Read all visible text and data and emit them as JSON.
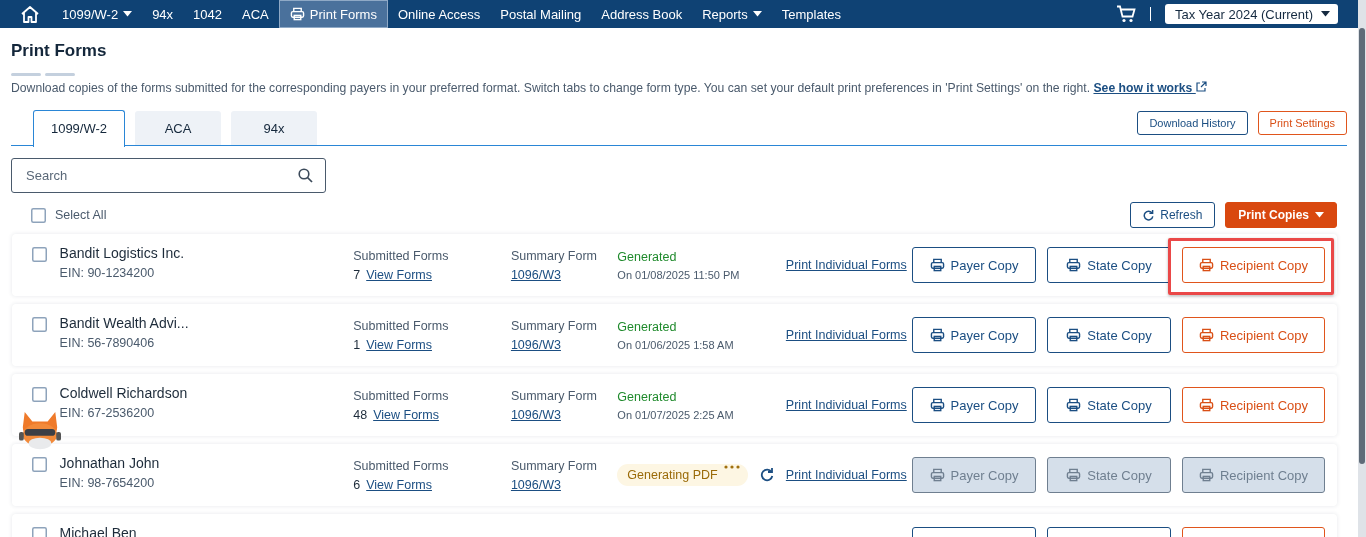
{
  "nav": {
    "items": [
      {
        "label": "1099/W-2",
        "dropdown": true,
        "selected": false
      },
      {
        "label": "94x",
        "dropdown": false,
        "selected": false
      },
      {
        "label": "1042",
        "dropdown": false,
        "selected": false
      },
      {
        "label": "ACA",
        "dropdown": false,
        "selected": false
      },
      {
        "label": "Print Forms",
        "dropdown": false,
        "selected": true,
        "kind": "printer"
      },
      {
        "label": "Online Access",
        "dropdown": false,
        "selected": false
      },
      {
        "label": "Postal Mailing",
        "dropdown": false,
        "selected": false
      },
      {
        "label": "Address Book",
        "dropdown": false,
        "selected": false
      },
      {
        "label": "Reports",
        "dropdown": true,
        "selected": false
      },
      {
        "label": "Templates",
        "dropdown": false,
        "selected": false
      }
    ],
    "tax_year": "Tax Year 2024 (Current)"
  },
  "page": {
    "title": "Print Forms",
    "description": "Download copies of the forms submitted for the corresponding payers in your preferred format. Switch tabs to change form type. You can set your default print preferences in 'Print Settings' on the right.",
    "help_link": "See how it works"
  },
  "tabs": [
    {
      "label": "1099/W-2",
      "selected": true
    },
    {
      "label": "ACA",
      "selected": false
    },
    {
      "label": "94x",
      "selected": false
    }
  ],
  "header_buttons": [
    {
      "label": "Download History",
      "kind": "secondary"
    },
    {
      "label": "Print Settings",
      "kind": "accent"
    }
  ],
  "search": {
    "placeholder": "Search"
  },
  "select_all": {
    "label": "Select All",
    "checked": false
  },
  "actions": [
    {
      "label": "Refresh",
      "kind": "refresh"
    },
    {
      "label": "Print Copies",
      "kind": "primary"
    }
  ],
  "rows": [
    {
      "name": "Bandit Logistics Inc.",
      "ein": "EIN: 90-1234200",
      "checked": false,
      "submitted_label": "Submitted Forms",
      "count": "7",
      "view_link": "View Forms",
      "summary_label": "Summary Form",
      "summary_link": "1096/W3",
      "status": {
        "kind": "generated",
        "label": "Generated",
        "date": "On 01/08/2025 11:50 PM"
      },
      "print_link": "Print Individual Forms",
      "buttons": [
        {
          "label": "Payer Copy",
          "kind": "secondary",
          "disabled": false,
          "highlighted": false
        },
        {
          "label": "State Copy",
          "kind": "secondary",
          "disabled": false,
          "highlighted": false
        },
        {
          "label": "Recipient Copy",
          "kind": "accent",
          "disabled": false,
          "highlighted": true
        }
      ]
    },
    {
      "name": "Bandit Wealth Advi...",
      "ein": "EIN: 56-7890406",
      "checked": false,
      "submitted_label": "Submitted Forms",
      "count": "1",
      "view_link": "View Forms",
      "summary_label": "Summary Form",
      "summary_link": "1096/W3",
      "status": {
        "kind": "generated",
        "label": "Generated",
        "date": "On 01/06/2025 1:58 AM"
      },
      "print_link": "Print Individual Forms",
      "buttons": [
        {
          "label": "Payer Copy",
          "kind": "secondary",
          "disabled": false,
          "highlighted": false
        },
        {
          "label": "State Copy",
          "kind": "secondary",
          "disabled": false,
          "highlighted": false
        },
        {
          "label": "Recipient Copy",
          "kind": "accent",
          "disabled": false,
          "highlighted": false
        }
      ]
    },
    {
      "name": "Coldwell Richardson",
      "ein": "EIN: 67-2536200",
      "checked": false,
      "submitted_label": "Submitted Forms",
      "count": "48",
      "view_link": "View Forms",
      "summary_label": "Summary Form",
      "summary_link": "1096/W3",
      "status": {
        "kind": "generated",
        "label": "Generated",
        "date": "On 01/07/2025 2:25 AM"
      },
      "print_link": "Print Individual Forms",
      "buttons": [
        {
          "label": "Payer Copy",
          "kind": "secondary",
          "disabled": false,
          "highlighted": false
        },
        {
          "label": "State Copy",
          "kind": "secondary",
          "disabled": false,
          "highlighted": false
        },
        {
          "label": "Recipient Copy",
          "kind": "accent",
          "disabled": false,
          "highlighted": false
        }
      ]
    },
    {
      "name": "Johnathan John",
      "ein": "EIN: 98-7654200",
      "checked": false,
      "submitted_label": "Submitted Forms",
      "count": "6",
      "view_link": "View Forms",
      "summary_label": "Summary Form",
      "summary_link": "1096/W3",
      "status": {
        "kind": "generating",
        "label": "Generating PDF"
      },
      "print_link": "Print Individual Forms",
      "buttons": [
        {
          "label": "Payer Copy",
          "kind": "secondary",
          "disabled": true,
          "highlighted": false
        },
        {
          "label": "State Copy",
          "kind": "secondary",
          "disabled": true,
          "highlighted": false
        },
        {
          "label": "Recipient Copy",
          "kind": "accent",
          "disabled": true,
          "highlighted": false
        }
      ]
    },
    {
      "name": "Michael Ben",
      "checked": false,
      "buttons": [
        {
          "kind": "secondary",
          "disabled": false,
          "highlighted": false
        },
        {
          "kind": "secondary",
          "disabled": false,
          "highlighted": false
        },
        {
          "kind": "accent",
          "disabled": false,
          "highlighted": false
        }
      ]
    }
  ]
}
